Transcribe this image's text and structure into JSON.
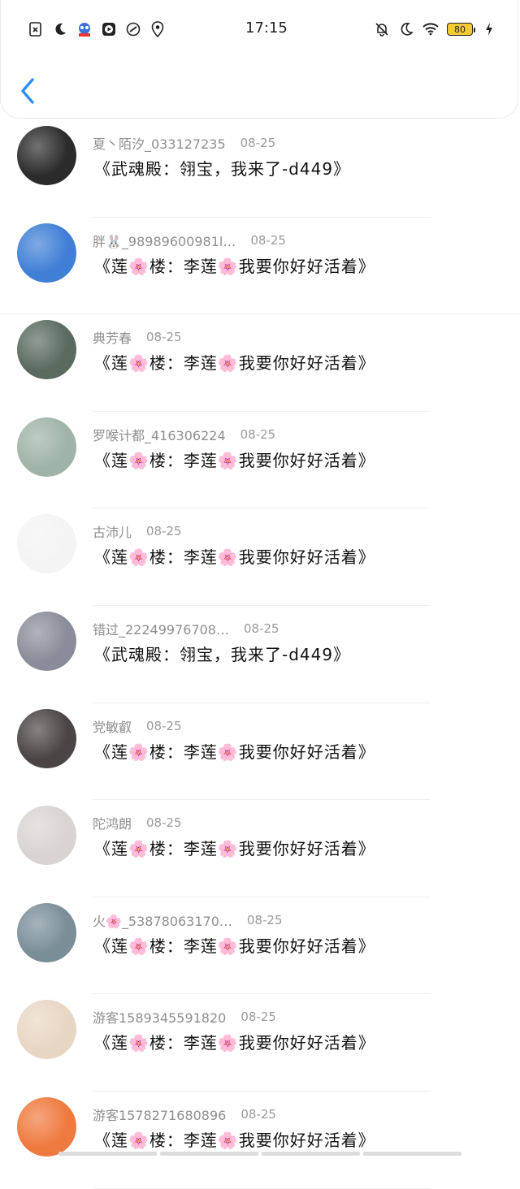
{
  "status_bar": {
    "time": "17:15",
    "battery_level": "80",
    "left_icons": [
      "sim-error-icon",
      "moon-icon",
      "app-badge-icon",
      "media-play-icon",
      "link-icon",
      "location-icon"
    ],
    "right_icons": [
      "bell-off-icon",
      "moon-icon",
      "wifi-icon",
      "battery-icon",
      "charging-icon"
    ]
  },
  "nav": {
    "back_icon": "chevron-left-icon",
    "accent": "#2f8ff2"
  },
  "comments": [
    {
      "user": "夏丶陌汐_033127235",
      "date": "08-25",
      "text": "《武魂殿：翎宝，我来了-d449》",
      "avatar_color": "#2b2b2b"
    },
    {
      "user": "胖🐰_98989600981l…",
      "date": "08-25",
      "text": "《莲🌸楼：李莲🌸我要你好好活着》",
      "avatar_color": "#3f7fd6"
    },
    {
      "user": "典芳春",
      "date": "08-25",
      "text": "《莲🌸楼：李莲🌸我要你好好活着》",
      "avatar_color": "#5a6b5e"
    },
    {
      "user": "罗喉计都_416306224",
      "date": "08-25",
      "text": "《莲🌸楼：李莲🌸我要你好好活着》",
      "avatar_color": "#9fb3a6"
    },
    {
      "user": "古沛儿",
      "date": "08-25",
      "text": "《莲🌸楼：李莲🌸我要你好好活着》",
      "avatar_color": "#f4f4f4"
    },
    {
      "user": "错过_22249976708…",
      "date": "08-25",
      "text": "《武魂殿：翎宝，我来了-d449》",
      "avatar_color": "#8a8c99"
    },
    {
      "user": "党敏叡",
      "date": "08-25",
      "text": "《莲🌸楼：李莲🌸我要你好好活着》",
      "avatar_color": "#4a4444"
    },
    {
      "user": "陀鸿朗",
      "date": "08-25",
      "text": "《莲🌸楼：李莲🌸我要你好好活着》",
      "avatar_color": "#d9d4d2"
    },
    {
      "user": "火🌸_53878063170…",
      "date": "08-25",
      "text": "《莲🌸楼：李莲🌸我要你好好活着》",
      "avatar_color": "#7a8e98"
    },
    {
      "user": "游客1589345591820",
      "date": "08-25",
      "text": "《莲🌸楼：李莲🌸我要你好好活着》",
      "avatar_color": "#e8d6c4"
    },
    {
      "user": "游客1578271680896",
      "date": "08-25",
      "text": "《莲🌸楼：李莲🌸我要你好好活着》",
      "avatar_color": "#ef7a3f"
    }
  ]
}
